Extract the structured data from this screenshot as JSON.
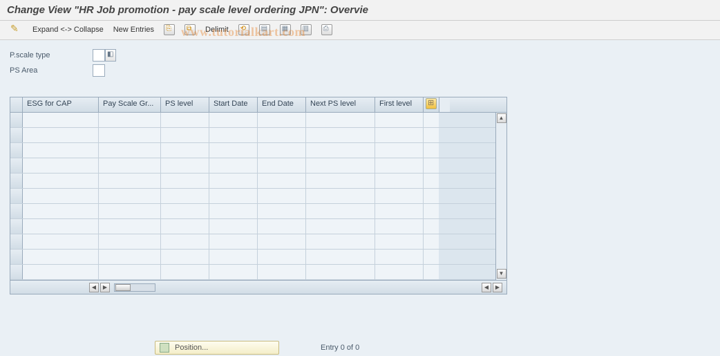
{
  "title": "Change View \"HR Job promotion - pay scale level ordering JPN\": Overvie",
  "toolbar": {
    "expand_collapse": "Expand <-> Collapse",
    "new_entries": "New Entries",
    "delimit": "Delimit"
  },
  "form": {
    "pscale_type_label": "P.scale type",
    "pscale_type_value": "",
    "ps_area_label": "PS Area",
    "ps_area_value": ""
  },
  "table": {
    "columns": {
      "esg": "ESG for CAP",
      "psg": "Pay Scale Gr...",
      "psl": "PS level",
      "sd": "Start Date",
      "ed": "End Date",
      "npsl": "Next PS level",
      "fl": "First level"
    },
    "row_count": 11
  },
  "footer": {
    "position_btn": "Position...",
    "entry_text": "Entry 0 of 0"
  },
  "watermark": "www.tutorialkart.com"
}
